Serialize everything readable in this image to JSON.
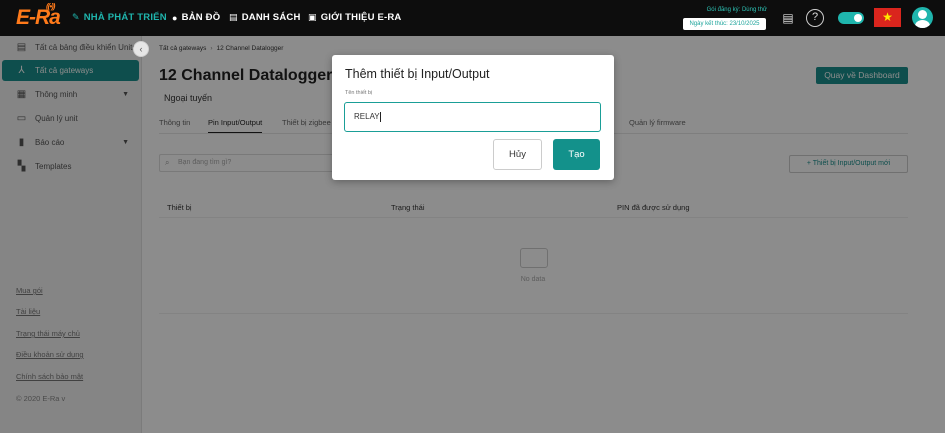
{
  "header": {
    "logo": "E-Ra",
    "nav": {
      "developer": "NHÀ PHÁT TRIỂN",
      "map": "BẢN ĐỒ",
      "list": "DANH SÁCH",
      "intro": "GIỚI THIỆU E-RA"
    },
    "registration_plan": "Gói đăng ký: Dùng thử",
    "registration_end": "Ngày kết thúc: 23/10/2025",
    "accent_color": "#1fb5ad"
  },
  "sidebar": {
    "items": [
      {
        "label": "Tất cả bảng điều khiển Units",
        "icon": "dashboard-icon"
      },
      {
        "label": "Tất cả gateways",
        "icon": "gateway-icon"
      },
      {
        "label": "Thông minh",
        "icon": "smart-icon"
      },
      {
        "label": "Quản lý unit",
        "icon": "unit-icon"
      },
      {
        "label": "Báo cáo",
        "icon": "report-icon"
      },
      {
        "label": "Templates",
        "icon": "templates-icon"
      }
    ],
    "footer_links": [
      "Mua gói",
      "Tài liệu",
      "Trạng thái máy chủ",
      "Điều khoản sử dụng",
      "Chính sách bảo mật"
    ],
    "copyright": "© 2020 E-Ra v"
  },
  "main": {
    "breadcrumb": [
      "Tất cả gateways",
      "12 Channel Datalogger"
    ],
    "title": "12 Channel Datalogger",
    "status": "Ngoại tuyến",
    "back_button": "Quay về Dashboard",
    "tabs": [
      "Thông tin",
      "Pin Input/Output",
      "Thiết bị zigbee",
      "Quản lý firmware"
    ],
    "search_placeholder": "Bạn đang tìm gì?",
    "new_button": "Thiết bị Input/Output mới",
    "table_headers": [
      "Thiết bị",
      "Trạng thái",
      "PIN đã được sử dụng"
    ],
    "empty_text": "No data"
  },
  "modal": {
    "title": "Thêm thiết bị Input/Output",
    "field_label": "Tên thiết bị",
    "field_value": "RELAY",
    "cancel_label": "Hủy",
    "create_label": "Tạo"
  }
}
